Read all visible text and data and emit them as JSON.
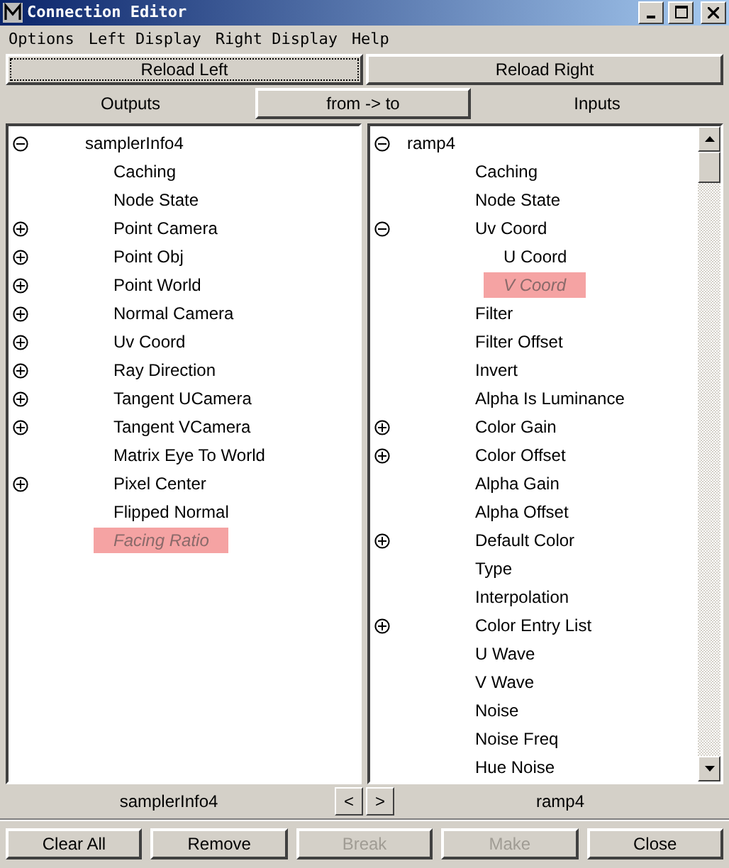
{
  "window": {
    "title": "Connection Editor"
  },
  "menu": [
    "Options",
    "Left Display",
    "Right Display",
    "Help"
  ],
  "reload_buttons": [
    {
      "label": "Reload Left",
      "focused": true
    },
    {
      "label": "Reload Right",
      "focused": false
    }
  ],
  "header": {
    "left": "Outputs",
    "mode_button": "from -> to",
    "right": "Inputs"
  },
  "left_tree": [
    {
      "label": "samplerInfo4",
      "kind": "compound",
      "expanded": true,
      "highlighted": false,
      "children": [
        {
          "label": "Caching",
          "kind": "attr",
          "highlighted": false
        },
        {
          "label": "Node State",
          "kind": "attr",
          "highlighted": false
        },
        {
          "label": "Point Camera",
          "kind": "compound",
          "expanded": false,
          "highlighted": false
        },
        {
          "label": "Point Obj",
          "kind": "compound",
          "expanded": false,
          "highlighted": false
        },
        {
          "label": "Point World",
          "kind": "compound",
          "expanded": false,
          "highlighted": false
        },
        {
          "label": "Normal Camera",
          "kind": "compound",
          "expanded": false,
          "highlighted": false
        },
        {
          "label": "Uv Coord",
          "kind": "compound",
          "expanded": false,
          "highlighted": false
        },
        {
          "label": "Ray Direction",
          "kind": "compound",
          "expanded": false,
          "highlighted": false
        },
        {
          "label": "Tangent UCamera",
          "kind": "compound",
          "expanded": false,
          "highlighted": false
        },
        {
          "label": "Tangent VCamera",
          "kind": "compound",
          "expanded": false,
          "highlighted": false
        },
        {
          "label": "Matrix Eye To World",
          "kind": "attr",
          "highlighted": false
        },
        {
          "label": "Pixel Center",
          "kind": "compound",
          "expanded": false,
          "highlighted": false
        },
        {
          "label": "Flipped Normal",
          "kind": "attr",
          "highlighted": false
        },
        {
          "label": "Facing Ratio",
          "kind": "attr",
          "highlighted": true
        }
      ]
    }
  ],
  "right_tree": [
    {
      "label": "ramp4",
      "kind": "compound",
      "expanded": true,
      "highlighted": false,
      "children": [
        {
          "label": "Caching",
          "kind": "attr",
          "highlighted": false
        },
        {
          "label": "Node State",
          "kind": "attr",
          "highlighted": false
        },
        {
          "label": "Uv Coord",
          "kind": "compound",
          "expanded": true,
          "highlighted": false,
          "children": [
            {
              "label": "U Coord",
              "kind": "attr",
              "highlighted": false
            },
            {
              "label": "V Coord",
              "kind": "attr",
              "highlighted": true
            }
          ]
        },
        {
          "label": "Filter",
          "kind": "attr",
          "highlighted": false
        },
        {
          "label": "Filter Offset",
          "kind": "attr",
          "highlighted": false
        },
        {
          "label": "Invert",
          "kind": "attr",
          "highlighted": false
        },
        {
          "label": "Alpha Is Luminance",
          "kind": "attr",
          "highlighted": false
        },
        {
          "label": "Color Gain",
          "kind": "compound",
          "expanded": false,
          "highlighted": false
        },
        {
          "label": "Color Offset",
          "kind": "compound",
          "expanded": false,
          "highlighted": false
        },
        {
          "label": "Alpha Gain",
          "kind": "attr",
          "highlighted": false
        },
        {
          "label": "Alpha Offset",
          "kind": "attr",
          "highlighted": false
        },
        {
          "label": "Default Color",
          "kind": "compound",
          "expanded": false,
          "highlighted": false
        },
        {
          "label": "Type",
          "kind": "attr",
          "highlighted": false
        },
        {
          "label": "Interpolation",
          "kind": "attr",
          "highlighted": false
        },
        {
          "label": "Color Entry List",
          "kind": "compound",
          "expanded": false,
          "highlighted": false
        },
        {
          "label": "U Wave",
          "kind": "attr",
          "highlighted": false
        },
        {
          "label": "V Wave",
          "kind": "attr",
          "highlighted": false
        },
        {
          "label": "Noise",
          "kind": "attr",
          "highlighted": false
        },
        {
          "label": "Noise Freq",
          "kind": "attr",
          "highlighted": false
        },
        {
          "label": "Hue Noise",
          "kind": "attr",
          "highlighted": false
        }
      ]
    }
  ],
  "footer": {
    "left_node": "samplerInfo4",
    "prev": "<",
    "next": ">",
    "right_node": "ramp4"
  },
  "buttons": [
    {
      "label": "Clear All",
      "disabled": false
    },
    {
      "label": "Remove",
      "disabled": false
    },
    {
      "label": "Break",
      "disabled": true
    },
    {
      "label": "Make",
      "disabled": true
    },
    {
      "label": "Close",
      "disabled": false
    }
  ]
}
